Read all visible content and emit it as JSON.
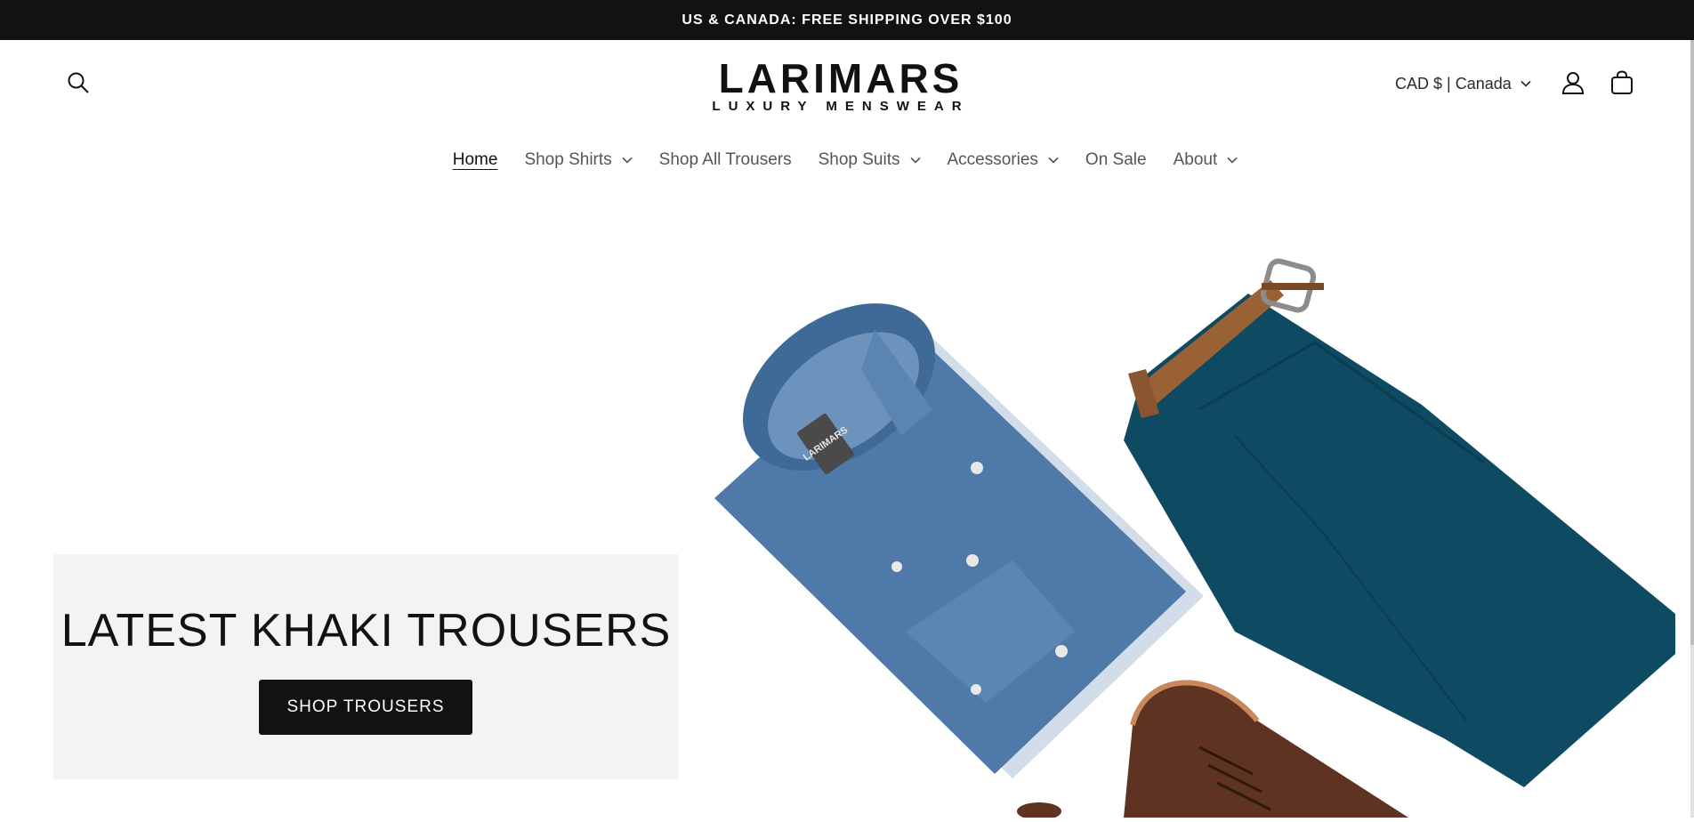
{
  "announcement": {
    "text": "US & CANADA: FREE SHIPPING OVER $100"
  },
  "header": {
    "logo_text": "LARIMARS",
    "logo_tagline": "LUXURY MENSWEAR",
    "country_selector": "CAD $ | Canada",
    "icons": [
      "search-icon",
      "account-icon",
      "cart-icon",
      "chevron-down-icon"
    ]
  },
  "nav": {
    "items": [
      {
        "label": "Home",
        "active": true
      },
      {
        "label": "Shop Shirts",
        "has_dropdown": true
      },
      {
        "label": "Shop All Trousers"
      },
      {
        "label": "Shop Suits",
        "has_dropdown": true
      },
      {
        "label": "Accessories",
        "has_dropdown": true
      },
      {
        "label": "On Sale"
      },
      {
        "label": "About",
        "has_dropdown": true
      }
    ]
  },
  "hero": {
    "title": "LATEST KHAKI TROUSERS",
    "cta_label": "SHOP TROUSERS",
    "shirt_label_text": "LARIMARS"
  },
  "colors": {
    "announcement_bg": "#121212",
    "panel_bg": "#f3f3f3",
    "button_bg": "#121212",
    "denim": "#4f79a8",
    "trouser_teal": "#0f4a63",
    "belt_brown": "#9a6234",
    "shoe_brown": "#5e3322"
  }
}
